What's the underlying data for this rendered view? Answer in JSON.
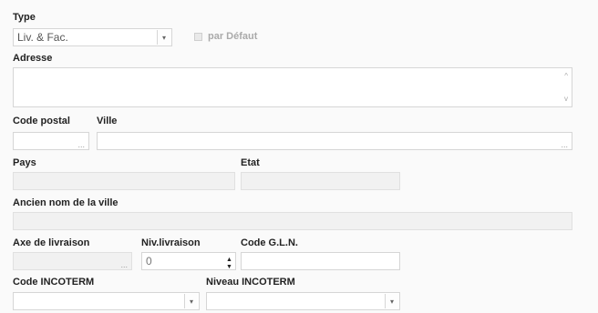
{
  "type": {
    "label": "Type",
    "value": "Liv. & Fac."
  },
  "default_checkbox": {
    "label": "par Défaut",
    "checked": false
  },
  "adresse": {
    "label": "Adresse",
    "value": ""
  },
  "code_postal": {
    "label": "Code postal",
    "value": ""
  },
  "ville": {
    "label": "Ville",
    "value": ""
  },
  "pays": {
    "label": "Pays",
    "value": ""
  },
  "etat": {
    "label": "Etat",
    "value": ""
  },
  "ancien_nom": {
    "label": "Ancien nom de la ville",
    "value": ""
  },
  "axe_livraison": {
    "label": "Axe de livraison",
    "value": ""
  },
  "niv_livraison": {
    "label": "Niv.livraison",
    "value": "0"
  },
  "code_gln": {
    "label": "Code G.L.N.",
    "value": ""
  },
  "code_incoterm": {
    "label": "Code INCOTERM",
    "value": ""
  },
  "niveau_incoterm": {
    "label": "Niveau INCOTERM",
    "value": ""
  },
  "icons": {
    "ellipsis": "...",
    "dropdown": "▾",
    "scroll_up": "^",
    "scroll_down": "v",
    "spin_up": "▲",
    "spin_down": "▼"
  }
}
